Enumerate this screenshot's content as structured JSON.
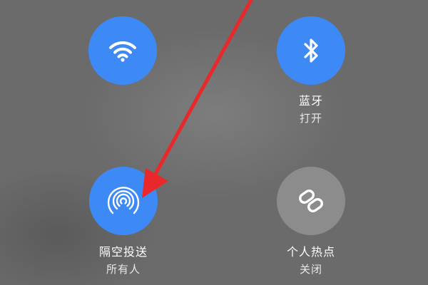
{
  "colors": {
    "active": "#3d8af7",
    "inactive": "#8c8c8c",
    "background": "#6b6b6b",
    "annotation_arrow": "#e8282b"
  },
  "tiles": [
    {
      "id": "wifi",
      "icon": "wifi-icon",
      "state": "on",
      "label": "",
      "status": ""
    },
    {
      "id": "bluetooth",
      "icon": "bluetooth-icon",
      "state": "on",
      "label": "蓝牙",
      "status": "打开"
    },
    {
      "id": "airdrop",
      "icon": "airdrop-icon",
      "state": "on",
      "label": "隔空投送",
      "status": "所有人"
    },
    {
      "id": "hotspot",
      "icon": "hotspot-icon",
      "state": "off",
      "label": "个人热点",
      "status": "关闭"
    }
  ]
}
